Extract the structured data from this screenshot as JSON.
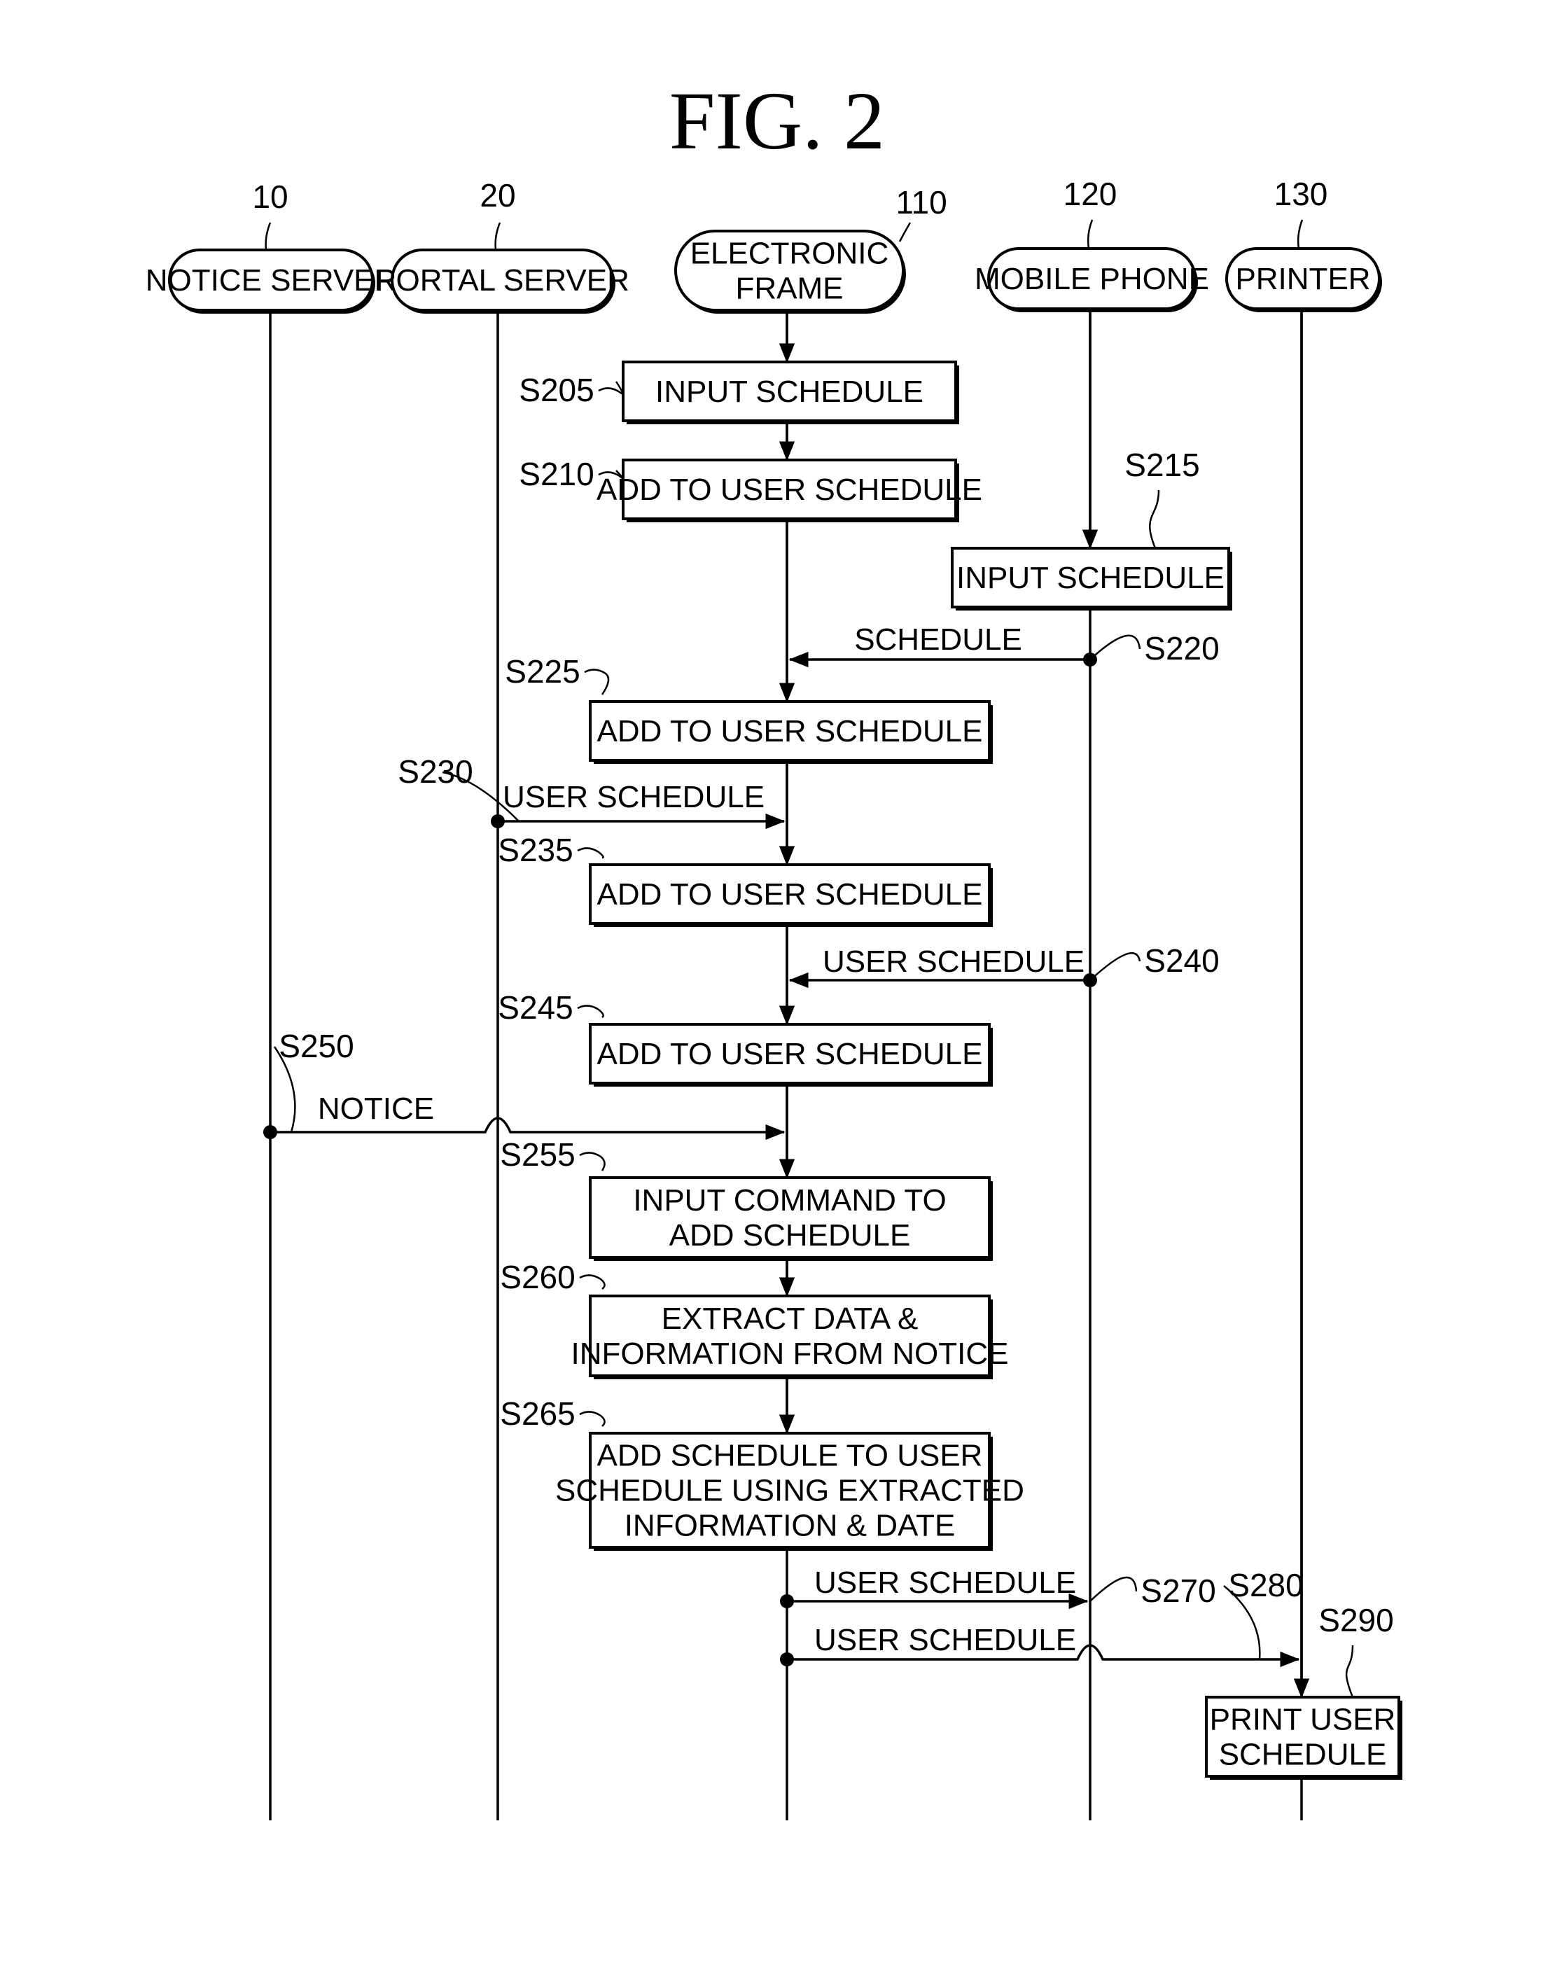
{
  "figure": {
    "title": "FIG.  2"
  },
  "actors": [
    {
      "id": "notice",
      "ref": "10",
      "label": [
        "NOTICE SERVER"
      ]
    },
    {
      "id": "portal",
      "ref": "20",
      "label": [
        "PORTAL SERVER"
      ]
    },
    {
      "id": "frame",
      "ref": "110",
      "label": [
        "ELECTRONIC",
        "FRAME"
      ]
    },
    {
      "id": "mobile",
      "ref": "120",
      "label": [
        "MOBILE PHONE"
      ]
    },
    {
      "id": "printer",
      "ref": "130",
      "label": [
        "PRINTER"
      ]
    }
  ],
  "steps": [
    {
      "id": "S205",
      "actor": "frame",
      "text": [
        "INPUT SCHEDULE"
      ]
    },
    {
      "id": "S210",
      "actor": "frame",
      "text": [
        "ADD TO USER SCHEDULE"
      ]
    },
    {
      "id": "S215",
      "actor": "mobile",
      "text": [
        "INPUT SCHEDULE"
      ]
    },
    {
      "id": "S225",
      "actor": "frame",
      "text": [
        "ADD TO USER SCHEDULE"
      ]
    },
    {
      "id": "S235",
      "actor": "frame",
      "text": [
        "ADD TO USER SCHEDULE"
      ]
    },
    {
      "id": "S245",
      "actor": "frame",
      "text": [
        "ADD TO USER SCHEDULE"
      ]
    },
    {
      "id": "S255",
      "actor": "frame",
      "text": [
        "INPUT COMMAND TO",
        "ADD SCHEDULE"
      ]
    },
    {
      "id": "S260",
      "actor": "frame",
      "text": [
        "EXTRACT DATA &",
        "INFORMATION FROM NOTICE"
      ]
    },
    {
      "id": "S265",
      "actor": "frame",
      "text": [
        "ADD SCHEDULE TO USER",
        "SCHEDULE USING EXTRACTED",
        "INFORMATION & DATE"
      ]
    },
    {
      "id": "S290",
      "actor": "printer",
      "text": [
        "PRINT USER",
        "SCHEDULE"
      ]
    }
  ],
  "messages": [
    {
      "id": "S220",
      "from": "mobile",
      "to": "frame",
      "label": "SCHEDULE"
    },
    {
      "id": "S230",
      "from": "portal",
      "to": "frame",
      "label": "USER SCHEDULE"
    },
    {
      "id": "S240",
      "from": "mobile",
      "to": "frame",
      "label": "USER SCHEDULE"
    },
    {
      "id": "S250",
      "from": "notice",
      "to": "frame",
      "label": "NOTICE"
    },
    {
      "id": "S270",
      "from": "frame",
      "to": "mobile",
      "label": "USER SCHEDULE"
    },
    {
      "id": "S280",
      "from": "frame",
      "to": "printer",
      "label": "USER SCHEDULE"
    }
  ]
}
